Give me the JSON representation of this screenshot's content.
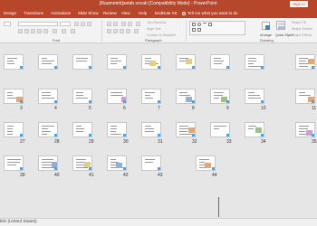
{
  "window": {
    "title": "[Raumeteb]setab.vocab [Compatibility Mode] - PowerPoint",
    "signin_label": "Sign in"
  },
  "tabs": [
    "Design",
    "Transitions",
    "Animations",
    "Slide Show",
    "Review",
    "View",
    "Help",
    "EndNote X8"
  ],
  "tell_me": "Tell me what you want to do",
  "ribbon": {
    "groups": [
      "Font",
      "Paragraph",
      "Drawing"
    ],
    "text_direction": "Text Direction",
    "align_text": "Align Text",
    "convert_smartart": "Convert to SmartArt",
    "arrange": "Arrange",
    "quick_styles": "Quick Styles",
    "shape_fill": "Shape Fill",
    "shape_outline": "Shape Outline",
    "shape_effects": "Shape Effects"
  },
  "slides": {
    "row1_numbers": [],
    "row2_numbers": [
      "3",
      "4",
      "5",
      "6",
      "7",
      "8",
      "9",
      "10",
      "11"
    ],
    "row3_numbers": [
      "27",
      "28",
      "29",
      "30",
      "31",
      "32",
      "33",
      "34",
      "35"
    ],
    "row4_numbers": [
      "39",
      "40",
      "41",
      "42",
      "43",
      "44"
    ]
  },
  "status": {
    "language": "lish (United States)"
  }
}
